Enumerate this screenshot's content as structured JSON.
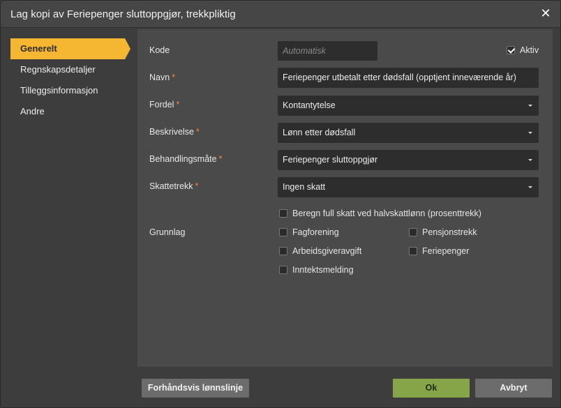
{
  "dialog": {
    "title": "Lag kopi av Feriepenger sluttoppgjør, trekkpliktig",
    "close_symbol": "✕"
  },
  "sidebar": {
    "items": [
      {
        "label": "Generelt",
        "active": true
      },
      {
        "label": "Regnskapsdetaljer",
        "active": false
      },
      {
        "label": "Tilleggsinformasjon",
        "active": false
      },
      {
        "label": "Andre",
        "active": false
      }
    ]
  },
  "form": {
    "kode": {
      "label": "Kode",
      "placeholder": "Automatisk",
      "value": ""
    },
    "aktiv": {
      "label": "Aktiv",
      "checked": true
    },
    "navn": {
      "label": "Navn",
      "required": "*",
      "value": "Feriepenger utbetalt etter dødsfall (opptjent inneværende år)"
    },
    "fordel": {
      "label": "Fordel",
      "required": "*",
      "value": "Kontantytelse"
    },
    "beskrivelse": {
      "label": "Beskrivelse",
      "required": "*",
      "value": "Lønn etter dødsfall"
    },
    "behandlingsmate": {
      "label": "Behandlingsmåte",
      "required": "*",
      "value": "Feriepenger sluttoppgjør"
    },
    "skattetrekk": {
      "label": "Skattetrekk",
      "required": "*",
      "value": "Ingen skatt"
    },
    "full_skatt": {
      "label": "Beregn full skatt ved halvskattlønn (prosenttrekk)",
      "checked": false
    },
    "grunnlag": {
      "label": "Grunnlag",
      "options": [
        {
          "label": "Fagforening",
          "checked": false
        },
        {
          "label": "Pensjonstrekk",
          "checked": false
        },
        {
          "label": "Arbeidsgiveravgift",
          "checked": false
        },
        {
          "label": "Feriepenger",
          "checked": false
        },
        {
          "label": "Inntektsmelding",
          "checked": false
        }
      ]
    }
  },
  "footer": {
    "preview_label": "Forhåndsvis lønnslinje",
    "ok_label": "Ok",
    "cancel_label": "Avbryt"
  },
  "colors": {
    "accent": "#f5b731",
    "ok_button": "#86a548",
    "required_marker": "#f0883e"
  }
}
